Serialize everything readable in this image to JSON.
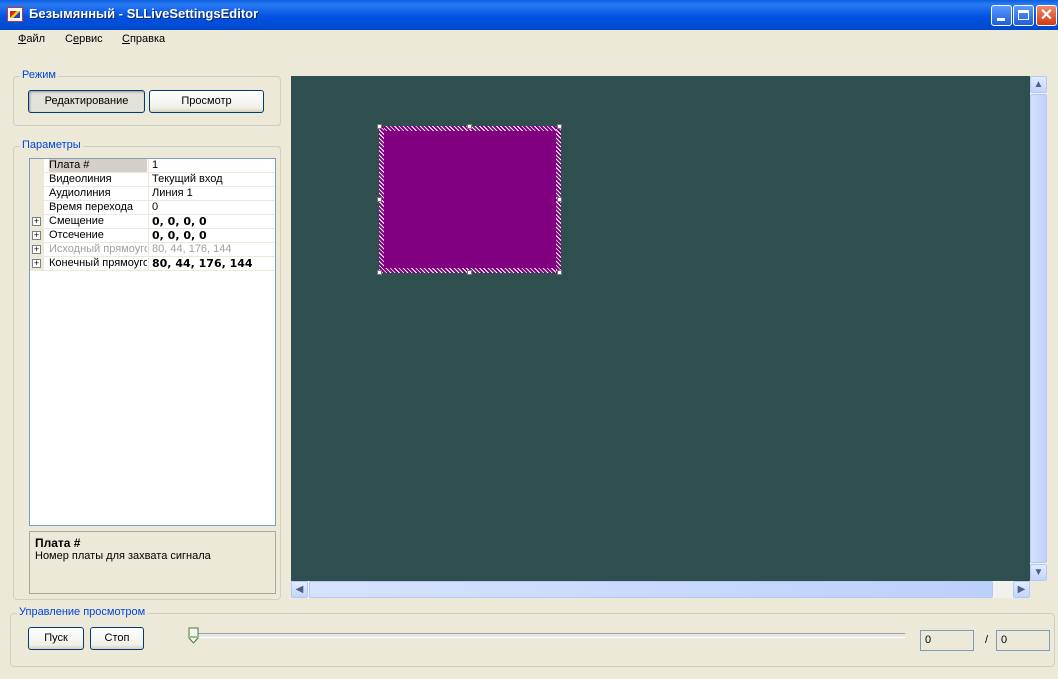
{
  "window": {
    "title": "Безымянный - SLLiveSettingsEditor"
  },
  "menu": [
    {
      "hotkey": "Ф",
      "rest": "айл"
    },
    {
      "pre": "С",
      "hotkey": "е",
      "rest": "рвис"
    },
    {
      "hotkey": "С",
      "rest": "правка"
    }
  ],
  "mode": {
    "title": "Режим",
    "edit_label": "Редактирование",
    "view_label": "Просмотр"
  },
  "params": {
    "title": "Параметры",
    "rows": [
      {
        "name": "Плата #",
        "value": "1"
      },
      {
        "name": "Видеолиния",
        "value": "Текущий вход"
      },
      {
        "name": "Аудиолиния",
        "value": "Линия 1"
      },
      {
        "name": "Время перехода",
        "value": "0"
      },
      {
        "name": "Смещение",
        "value": "0, 0, 0, 0"
      },
      {
        "name": "Отсечение",
        "value": "0, 0, 0, 0"
      },
      {
        "name": "Исходный прямоугольник",
        "value": "80, 44, 176, 144"
      },
      {
        "name": "Конечный прямоугольник",
        "value": "80, 44, 176, 144"
      }
    ],
    "help_title": "Плата #",
    "help_text": "Номер платы для захвата сигнала"
  },
  "colors": {
    "canvas_bg": "#2f4f4f",
    "shape_fill": "#800080"
  },
  "playback": {
    "title": "Управление просмотром",
    "play_label": "Пуск",
    "stop_label": "Стоп",
    "position_value": "0",
    "separator": "/",
    "total_value": "0",
    "position_fraction": 0
  }
}
